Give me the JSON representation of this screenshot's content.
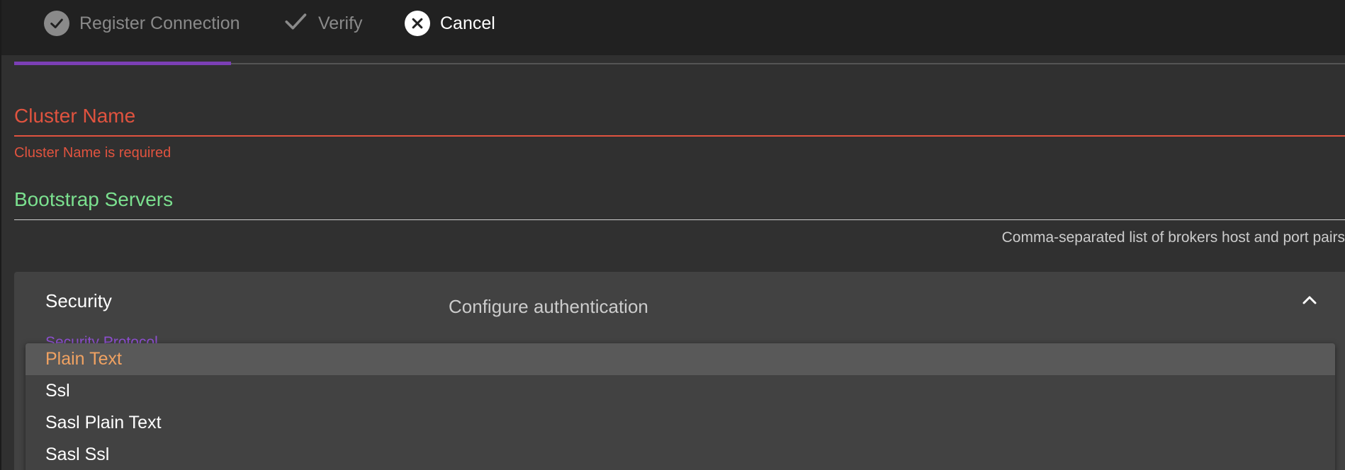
{
  "stepper": {
    "steps": [
      {
        "label": "Register Connection",
        "state": "completed"
      },
      {
        "label": "Verify",
        "state": "pending"
      }
    ],
    "cancel_label": "Cancel",
    "progress": 0.16
  },
  "form": {
    "cluster_name": {
      "label": "Cluster Name",
      "error": "Cluster Name is required",
      "value": ""
    },
    "bootstrap_servers": {
      "label": "Bootstrap Servers",
      "hint": "Comma-separated list of brokers host and port pairs",
      "value": ""
    }
  },
  "security": {
    "title": "Security",
    "description": "Configure authentication",
    "protocol_label": "Security Protocol",
    "expanded": true
  },
  "dropdown": {
    "options": [
      "Plain Text",
      "Ssl",
      "Sasl Plain Text",
      "Sasl Ssl"
    ],
    "selected_index": 0
  },
  "colors": {
    "error": "#e0533f",
    "valid": "#7be08f",
    "accent": "#7b3fb5",
    "selected_option": "#f0a262"
  },
  "icons": {
    "register_step": "check-circle-icon",
    "verify_step": "check-icon",
    "cancel": "close-circle-icon",
    "collapse": "chevron-up-icon"
  }
}
